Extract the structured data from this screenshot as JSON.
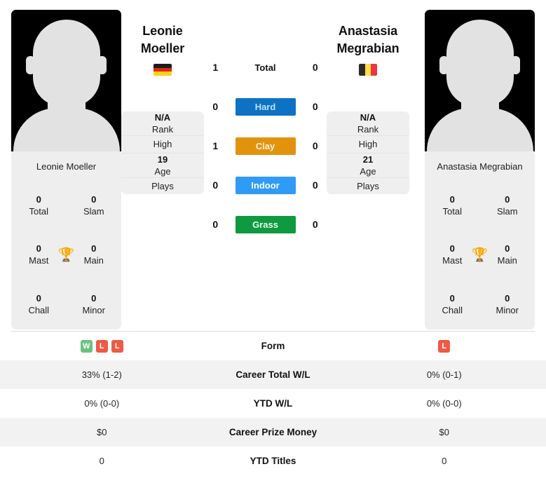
{
  "players": {
    "left": {
      "first_name": "Leonie",
      "last_name": "Moeller",
      "full_name": "Leonie Moeller",
      "country": "Germany",
      "flag_icon": "flag-germany-icon",
      "avatar_icon": "player-silhouette-icon",
      "rank": "N/A",
      "rank_label": "Rank",
      "high_label": "High",
      "high_value": "",
      "age": "19",
      "age_label": "Age",
      "plays_label": "Plays",
      "plays_value": "",
      "titles": [
        {
          "value": "0",
          "label": "Total"
        },
        {
          "value": "0",
          "label": "Slam"
        },
        {
          "value": "0",
          "label": "Mast"
        },
        {
          "value": "0",
          "label": "Main"
        },
        {
          "value": "0",
          "label": "Chall"
        },
        {
          "value": "0",
          "label": "Minor"
        }
      ],
      "form": [
        {
          "result": "W",
          "color": "#6bc27f"
        },
        {
          "result": "L",
          "color": "#ee5a45"
        },
        {
          "result": "L",
          "color": "#ee5a45"
        }
      ]
    },
    "right": {
      "first_name": "Anastasia",
      "last_name": "Megrabian",
      "full_name": "Anastasia Megrabian",
      "country": "Belgium",
      "flag_icon": "flag-belgium-icon",
      "avatar_icon": "player-silhouette-icon",
      "rank": "N/A",
      "rank_label": "Rank",
      "high_label": "High",
      "high_value": "",
      "age": "21",
      "age_label": "Age",
      "plays_label": "Plays",
      "plays_value": "",
      "titles": [
        {
          "value": "0",
          "label": "Total"
        },
        {
          "value": "0",
          "label": "Slam"
        },
        {
          "value": "0",
          "label": "Mast"
        },
        {
          "value": "0",
          "label": "Main"
        },
        {
          "value": "0",
          "label": "Chall"
        },
        {
          "value": "0",
          "label": "Minor"
        }
      ],
      "form": [
        {
          "result": "L",
          "color": "#ee5a45"
        }
      ]
    }
  },
  "trophy_icon": "trophy-icon",
  "surfaces": [
    {
      "label": "Total",
      "left": "1",
      "right": "0",
      "bg": "transparent",
      "fg": "#111111",
      "plain": true
    },
    {
      "label": "Hard",
      "left": "0",
      "right": "0",
      "bg": "#0e72c4",
      "fg": "#bfe0f7",
      "plain": false
    },
    {
      "label": "Clay",
      "left": "1",
      "right": "0",
      "bg": "#e2930d",
      "fg": "#fdf2dd",
      "plain": false
    },
    {
      "label": "Indoor",
      "left": "0",
      "right": "0",
      "bg": "#2f9bf5",
      "fg": "#ffffff",
      "plain": false
    },
    {
      "label": "Grass",
      "left": "0",
      "right": "0",
      "bg": "#0f9a3f",
      "fg": "#e8f7ec",
      "plain": false
    }
  ],
  "stats_table": {
    "rows": [
      {
        "label": "Form",
        "left": "",
        "right": "",
        "type": "form"
      },
      {
        "label": "Career Total W/L",
        "left": "33% (1-2)",
        "right": "0% (0-1)",
        "type": "text"
      },
      {
        "label": "YTD W/L",
        "left": "0% (0-0)",
        "right": "0% (0-0)",
        "type": "text"
      },
      {
        "label": "Career Prize Money",
        "left": "$0",
        "right": "$0",
        "type": "text"
      },
      {
        "label": "YTD Titles",
        "left": "0",
        "right": "0",
        "type": "text"
      }
    ]
  },
  "flag_colors": {
    "germany": [
      "#1c1c1c",
      "#de2910",
      "#fcd116"
    ],
    "belgium": [
      "#2d2926",
      "#fae042",
      "#ef3340"
    ]
  }
}
